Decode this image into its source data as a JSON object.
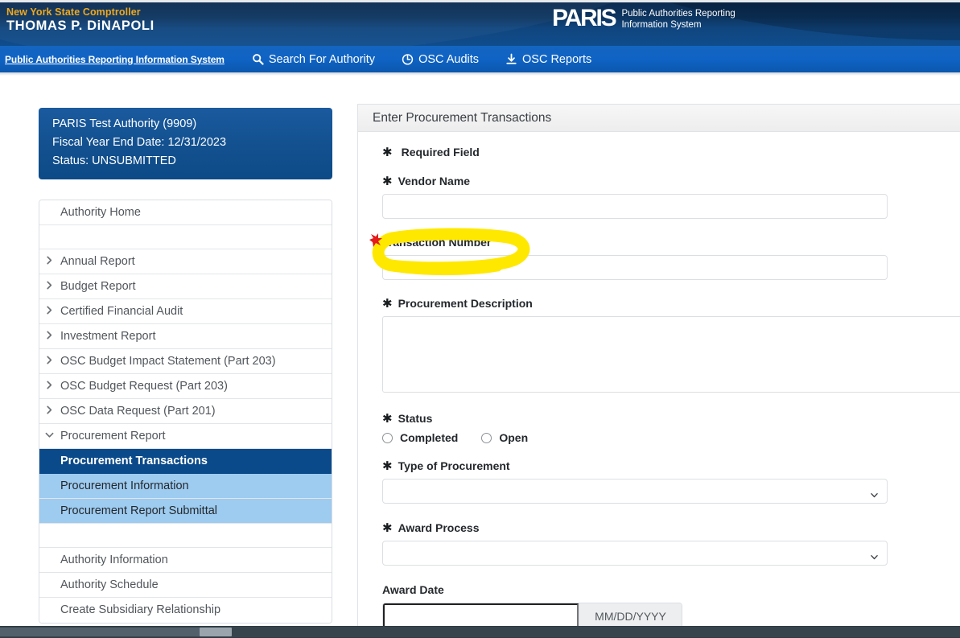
{
  "masthead": {
    "comptroller_line1": "New York State Comptroller",
    "comptroller_line2": "THOMAS P. DiNAPOLI",
    "brand_word": "PARIS",
    "brand_sub_line1": "Public Authorities Reporting",
    "brand_sub_line2": "Information System"
  },
  "navbar": {
    "brand_link": "Public Authorities Reporting Information System",
    "items": [
      {
        "label": "Search For Authority",
        "icon": "search-icon"
      },
      {
        "label": "OSC Audits",
        "icon": "clock-icon"
      },
      {
        "label": "OSC Reports",
        "icon": "download-icon"
      }
    ]
  },
  "sidebar": {
    "authority_box": {
      "name": "PARIS Test Authority (9909)",
      "fiscal_year": "Fiscal Year End Date: 12/31/2023",
      "status": "Status: UNSUBMITTED"
    },
    "menu": [
      {
        "label": "Authority Home",
        "type": "link",
        "chev": ""
      },
      {
        "label": "",
        "type": "spacer",
        "chev": ""
      },
      {
        "label": "Annual Report",
        "type": "group",
        "chev": "›"
      },
      {
        "label": "Budget Report",
        "type": "group",
        "chev": "›"
      },
      {
        "label": "Certified Financial Audit",
        "type": "group",
        "chev": "›"
      },
      {
        "label": "Investment Report",
        "type": "group",
        "chev": "›"
      },
      {
        "label": "OSC Budget Impact Statement (Part 203)",
        "type": "group",
        "chev": "›"
      },
      {
        "label": "OSC Budget Request (Part 203)",
        "type": "group",
        "chev": "›"
      },
      {
        "label": "OSC Data Request (Part 201)",
        "type": "group",
        "chev": "›"
      },
      {
        "label": "Procurement Report",
        "type": "group-open",
        "chev": "⌄"
      },
      {
        "label": "Procurement Transactions",
        "type": "sub-active",
        "chev": ""
      },
      {
        "label": "Procurement Information",
        "type": "sub",
        "chev": ""
      },
      {
        "label": "Procurement Report Submittal",
        "type": "sub",
        "chev": ""
      },
      {
        "label": "",
        "type": "spacer",
        "chev": ""
      },
      {
        "label": "Authority Information",
        "type": "link",
        "chev": ""
      },
      {
        "label": "Authority Schedule",
        "type": "link",
        "chev": ""
      },
      {
        "label": "Create Subsidiary Relationship",
        "type": "link-last",
        "chev": ""
      }
    ]
  },
  "panel": {
    "title": "Enter Procurement Transactions",
    "required_note": "Required Field",
    "required_marker": "✱",
    "fields": {
      "vendor_name_label": "Vendor Name",
      "vendor_name_value": "",
      "transaction_number_label": "Transaction Number",
      "transaction_number_value": "",
      "procurement_description_label": "Procurement Description",
      "procurement_description_value": "",
      "status_label": "Status",
      "status_option_completed": "Completed",
      "status_option_open": "Open",
      "type_of_procurement_label": "Type of Procurement",
      "type_of_procurement_value": "",
      "award_process_label": "Award Process",
      "award_process_value": "",
      "award_date_label": "Award Date",
      "award_date_value": "",
      "award_date_format": "MM/DD/YYYY"
    }
  },
  "annotation": {
    "highlight_color": "#FFE800",
    "marker_color": "#E31B1B",
    "target": "Transaction Number"
  }
}
